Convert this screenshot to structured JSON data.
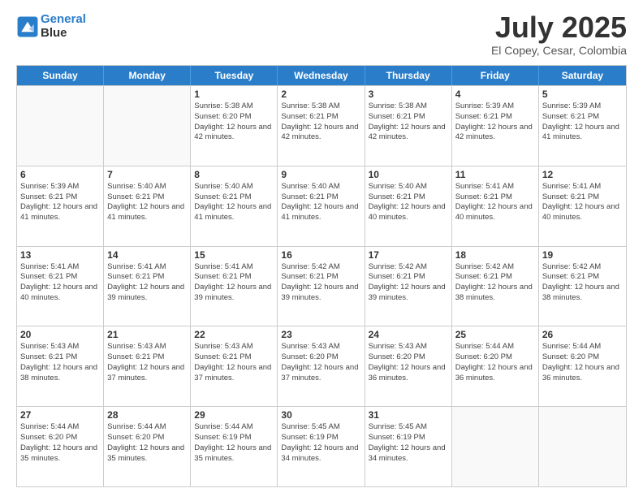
{
  "header": {
    "logo_line1": "General",
    "logo_line2": "Blue",
    "month": "July 2025",
    "location": "El Copey, Cesar, Colombia"
  },
  "days_of_week": [
    "Sunday",
    "Monday",
    "Tuesday",
    "Wednesday",
    "Thursday",
    "Friday",
    "Saturday"
  ],
  "weeks": [
    [
      {
        "day": "",
        "sunrise": "",
        "sunset": "",
        "daylight": "",
        "empty": true
      },
      {
        "day": "",
        "sunrise": "",
        "sunset": "",
        "daylight": "",
        "empty": true
      },
      {
        "day": "1",
        "sunrise": "Sunrise: 5:38 AM",
        "sunset": "Sunset: 6:20 PM",
        "daylight": "Daylight: 12 hours and 42 minutes."
      },
      {
        "day": "2",
        "sunrise": "Sunrise: 5:38 AM",
        "sunset": "Sunset: 6:21 PM",
        "daylight": "Daylight: 12 hours and 42 minutes."
      },
      {
        "day": "3",
        "sunrise": "Sunrise: 5:38 AM",
        "sunset": "Sunset: 6:21 PM",
        "daylight": "Daylight: 12 hours and 42 minutes."
      },
      {
        "day": "4",
        "sunrise": "Sunrise: 5:39 AM",
        "sunset": "Sunset: 6:21 PM",
        "daylight": "Daylight: 12 hours and 42 minutes."
      },
      {
        "day": "5",
        "sunrise": "Sunrise: 5:39 AM",
        "sunset": "Sunset: 6:21 PM",
        "daylight": "Daylight: 12 hours and 41 minutes."
      }
    ],
    [
      {
        "day": "6",
        "sunrise": "Sunrise: 5:39 AM",
        "sunset": "Sunset: 6:21 PM",
        "daylight": "Daylight: 12 hours and 41 minutes."
      },
      {
        "day": "7",
        "sunrise": "Sunrise: 5:40 AM",
        "sunset": "Sunset: 6:21 PM",
        "daylight": "Daylight: 12 hours and 41 minutes."
      },
      {
        "day": "8",
        "sunrise": "Sunrise: 5:40 AM",
        "sunset": "Sunset: 6:21 PM",
        "daylight": "Daylight: 12 hours and 41 minutes."
      },
      {
        "day": "9",
        "sunrise": "Sunrise: 5:40 AM",
        "sunset": "Sunset: 6:21 PM",
        "daylight": "Daylight: 12 hours and 41 minutes."
      },
      {
        "day": "10",
        "sunrise": "Sunrise: 5:40 AM",
        "sunset": "Sunset: 6:21 PM",
        "daylight": "Daylight: 12 hours and 40 minutes."
      },
      {
        "day": "11",
        "sunrise": "Sunrise: 5:41 AM",
        "sunset": "Sunset: 6:21 PM",
        "daylight": "Daylight: 12 hours and 40 minutes."
      },
      {
        "day": "12",
        "sunrise": "Sunrise: 5:41 AM",
        "sunset": "Sunset: 6:21 PM",
        "daylight": "Daylight: 12 hours and 40 minutes."
      }
    ],
    [
      {
        "day": "13",
        "sunrise": "Sunrise: 5:41 AM",
        "sunset": "Sunset: 6:21 PM",
        "daylight": "Daylight: 12 hours and 40 minutes."
      },
      {
        "day": "14",
        "sunrise": "Sunrise: 5:41 AM",
        "sunset": "Sunset: 6:21 PM",
        "daylight": "Daylight: 12 hours and 39 minutes."
      },
      {
        "day": "15",
        "sunrise": "Sunrise: 5:41 AM",
        "sunset": "Sunset: 6:21 PM",
        "daylight": "Daylight: 12 hours and 39 minutes."
      },
      {
        "day": "16",
        "sunrise": "Sunrise: 5:42 AM",
        "sunset": "Sunset: 6:21 PM",
        "daylight": "Daylight: 12 hours and 39 minutes."
      },
      {
        "day": "17",
        "sunrise": "Sunrise: 5:42 AM",
        "sunset": "Sunset: 6:21 PM",
        "daylight": "Daylight: 12 hours and 39 minutes."
      },
      {
        "day": "18",
        "sunrise": "Sunrise: 5:42 AM",
        "sunset": "Sunset: 6:21 PM",
        "daylight": "Daylight: 12 hours and 38 minutes."
      },
      {
        "day": "19",
        "sunrise": "Sunrise: 5:42 AM",
        "sunset": "Sunset: 6:21 PM",
        "daylight": "Daylight: 12 hours and 38 minutes."
      }
    ],
    [
      {
        "day": "20",
        "sunrise": "Sunrise: 5:43 AM",
        "sunset": "Sunset: 6:21 PM",
        "daylight": "Daylight: 12 hours and 38 minutes."
      },
      {
        "day": "21",
        "sunrise": "Sunrise: 5:43 AM",
        "sunset": "Sunset: 6:21 PM",
        "daylight": "Daylight: 12 hours and 37 minutes."
      },
      {
        "day": "22",
        "sunrise": "Sunrise: 5:43 AM",
        "sunset": "Sunset: 6:21 PM",
        "daylight": "Daylight: 12 hours and 37 minutes."
      },
      {
        "day": "23",
        "sunrise": "Sunrise: 5:43 AM",
        "sunset": "Sunset: 6:20 PM",
        "daylight": "Daylight: 12 hours and 37 minutes."
      },
      {
        "day": "24",
        "sunrise": "Sunrise: 5:43 AM",
        "sunset": "Sunset: 6:20 PM",
        "daylight": "Daylight: 12 hours and 36 minutes."
      },
      {
        "day": "25",
        "sunrise": "Sunrise: 5:44 AM",
        "sunset": "Sunset: 6:20 PM",
        "daylight": "Daylight: 12 hours and 36 minutes."
      },
      {
        "day": "26",
        "sunrise": "Sunrise: 5:44 AM",
        "sunset": "Sunset: 6:20 PM",
        "daylight": "Daylight: 12 hours and 36 minutes."
      }
    ],
    [
      {
        "day": "27",
        "sunrise": "Sunrise: 5:44 AM",
        "sunset": "Sunset: 6:20 PM",
        "daylight": "Daylight: 12 hours and 35 minutes."
      },
      {
        "day": "28",
        "sunrise": "Sunrise: 5:44 AM",
        "sunset": "Sunset: 6:20 PM",
        "daylight": "Daylight: 12 hours and 35 minutes."
      },
      {
        "day": "29",
        "sunrise": "Sunrise: 5:44 AM",
        "sunset": "Sunset: 6:19 PM",
        "daylight": "Daylight: 12 hours and 35 minutes."
      },
      {
        "day": "30",
        "sunrise": "Sunrise: 5:45 AM",
        "sunset": "Sunset: 6:19 PM",
        "daylight": "Daylight: 12 hours and 34 minutes."
      },
      {
        "day": "31",
        "sunrise": "Sunrise: 5:45 AM",
        "sunset": "Sunset: 6:19 PM",
        "daylight": "Daylight: 12 hours and 34 minutes."
      },
      {
        "day": "",
        "sunrise": "",
        "sunset": "",
        "daylight": "",
        "empty": true
      },
      {
        "day": "",
        "sunrise": "",
        "sunset": "",
        "daylight": "",
        "empty": true
      }
    ]
  ]
}
